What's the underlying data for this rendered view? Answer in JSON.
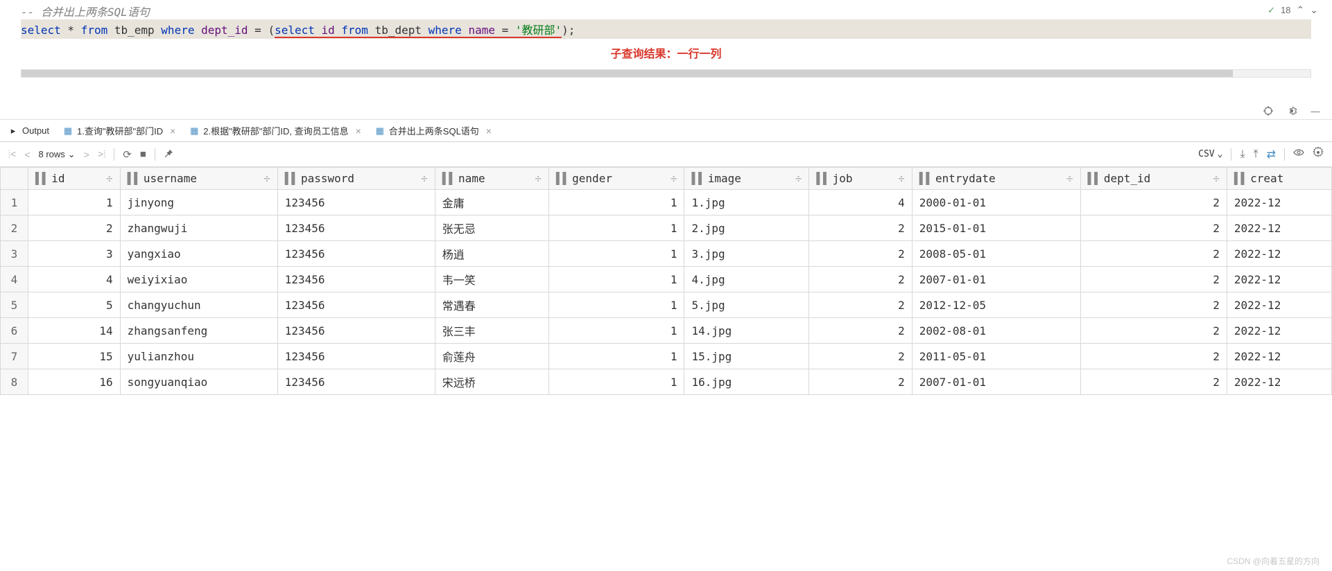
{
  "editor": {
    "comment": "-- 合并出上两条SQL语句",
    "sql": {
      "p1": "select",
      "p2": " * ",
      "p3": "from",
      "p4": " tb_emp ",
      "p5": "where",
      "p6": " dept_id ",
      "p7": "=",
      "p8": " (",
      "p9": "select",
      "p10": " id ",
      "p11": "from",
      "p12": " tb_dept ",
      "p13": "where",
      "p14": " name ",
      "p15": "=",
      "p16": " '教研部'",
      "p17": ");"
    },
    "annotation": "子查询结果：一行一列",
    "status_count": "18"
  },
  "tabs": {
    "output": "Output",
    "t1": "1.查询\"教研部\"部门ID",
    "t2": "2.根据\"教研部\"部门ID, 查询员工信息",
    "t3": "合并出上两条SQL语句"
  },
  "toolbar": {
    "rows_label": "8 rows",
    "csv_label": "CSV"
  },
  "columns": [
    "id",
    "username",
    "password",
    "name",
    "gender",
    "image",
    "job",
    "entrydate",
    "dept_id",
    "creat"
  ],
  "rows": [
    {
      "n": "1",
      "id": "1",
      "username": "jinyong",
      "password": "123456",
      "name": "金庸",
      "gender": "1",
      "image": "1.jpg",
      "job": "4",
      "entrydate": "2000-01-01",
      "dept_id": "2",
      "creat": "2022-12"
    },
    {
      "n": "2",
      "id": "2",
      "username": "zhangwuji",
      "password": "123456",
      "name": "张无忌",
      "gender": "1",
      "image": "2.jpg",
      "job": "2",
      "entrydate": "2015-01-01",
      "dept_id": "2",
      "creat": "2022-12"
    },
    {
      "n": "3",
      "id": "3",
      "username": "yangxiao",
      "password": "123456",
      "name": "杨逍",
      "gender": "1",
      "image": "3.jpg",
      "job": "2",
      "entrydate": "2008-05-01",
      "dept_id": "2",
      "creat": "2022-12"
    },
    {
      "n": "4",
      "id": "4",
      "username": "weiyixiao",
      "password": "123456",
      "name": "韦一笑",
      "gender": "1",
      "image": "4.jpg",
      "job": "2",
      "entrydate": "2007-01-01",
      "dept_id": "2",
      "creat": "2022-12"
    },
    {
      "n": "5",
      "id": "5",
      "username": "changyuchun",
      "password": "123456",
      "name": "常遇春",
      "gender": "1",
      "image": "5.jpg",
      "job": "2",
      "entrydate": "2012-12-05",
      "dept_id": "2",
      "creat": "2022-12"
    },
    {
      "n": "6",
      "id": "14",
      "username": "zhangsanfeng",
      "password": "123456",
      "name": "张三丰",
      "gender": "1",
      "image": "14.jpg",
      "job": "2",
      "entrydate": "2002-08-01",
      "dept_id": "2",
      "creat": "2022-12"
    },
    {
      "n": "7",
      "id": "15",
      "username": "yulianzhou",
      "password": "123456",
      "name": "俞莲舟",
      "gender": "1",
      "image": "15.jpg",
      "job": "2",
      "entrydate": "2011-05-01",
      "dept_id": "2",
      "creat": "2022-12"
    },
    {
      "n": "8",
      "id": "16",
      "username": "songyuanqiao",
      "password": "123456",
      "name": "宋远桥",
      "gender": "1",
      "image": "16.jpg",
      "job": "2",
      "entrydate": "2007-01-01",
      "dept_id": "2",
      "creat": "2022-12"
    }
  ],
  "watermark": "CSDN @向着五星的方向"
}
